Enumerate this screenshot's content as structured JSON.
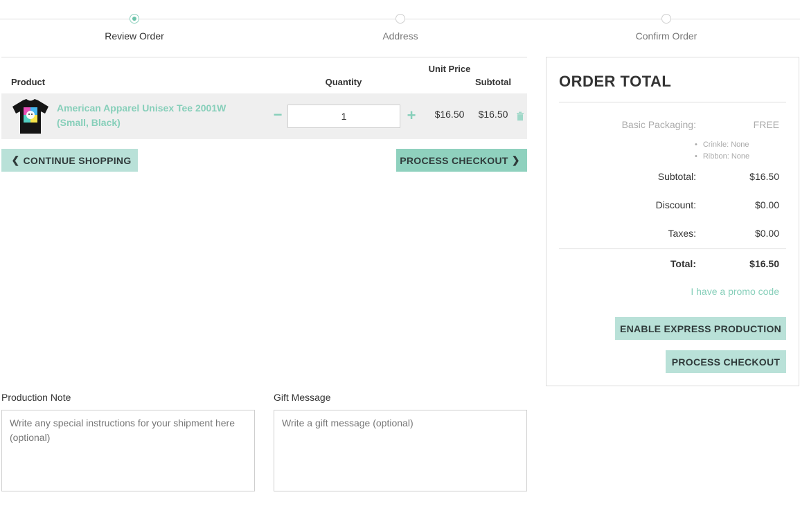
{
  "stepper": {
    "steps": [
      {
        "label": "Review Order",
        "active": true
      },
      {
        "label": "Address",
        "active": false
      },
      {
        "label": "Confirm Order",
        "active": false
      }
    ]
  },
  "cart": {
    "headers": {
      "product": "Product",
      "quantity": "Quantity",
      "unit_price": "Unit Price",
      "subtotal": "Subtotal"
    },
    "items": [
      {
        "name": "American Apparel Unisex Tee 2001W (Small, Black)",
        "quantity": "1",
        "unit_price": "$16.50",
        "subtotal": "$16.50",
        "thumb_icon": "tshirt-icon",
        "remove_icon": "trash-icon"
      }
    ],
    "qty_minus": "−",
    "qty_plus": "+"
  },
  "actions": {
    "continue_shopping": "CONTINUE SHOPPING",
    "process_checkout": "PROCESS CHECKOUT"
  },
  "order_total": {
    "title": "ORDER TOTAL",
    "packaging_label": "Basic Packaging:",
    "packaging_value": "FREE",
    "packaging_options": [
      "Crinkle: None",
      "Ribbon: None"
    ],
    "subtotal_label": "Subtotal:",
    "subtotal_value": "$16.50",
    "discount_label": "Discount:",
    "discount_value": "$0.00",
    "taxes_label": "Taxes:",
    "taxes_value": "$0.00",
    "total_label": "Total:",
    "total_value": "$16.50",
    "promo_link": "I have a promo code",
    "express_button": "ENABLE EXPRESS PRODUCTION",
    "checkout_button": "PROCESS CHECKOUT"
  },
  "notes": {
    "production_label": "Production Note",
    "production_placeholder": "Write any special instructions for your shipment here (optional)",
    "gift_label": "Gift Message",
    "gift_placeholder": "Write a gift message (optional)"
  },
  "colors": {
    "accent": "#87cfba",
    "button_light": "#b9e1d8",
    "button_dark": "#8fd1be"
  }
}
